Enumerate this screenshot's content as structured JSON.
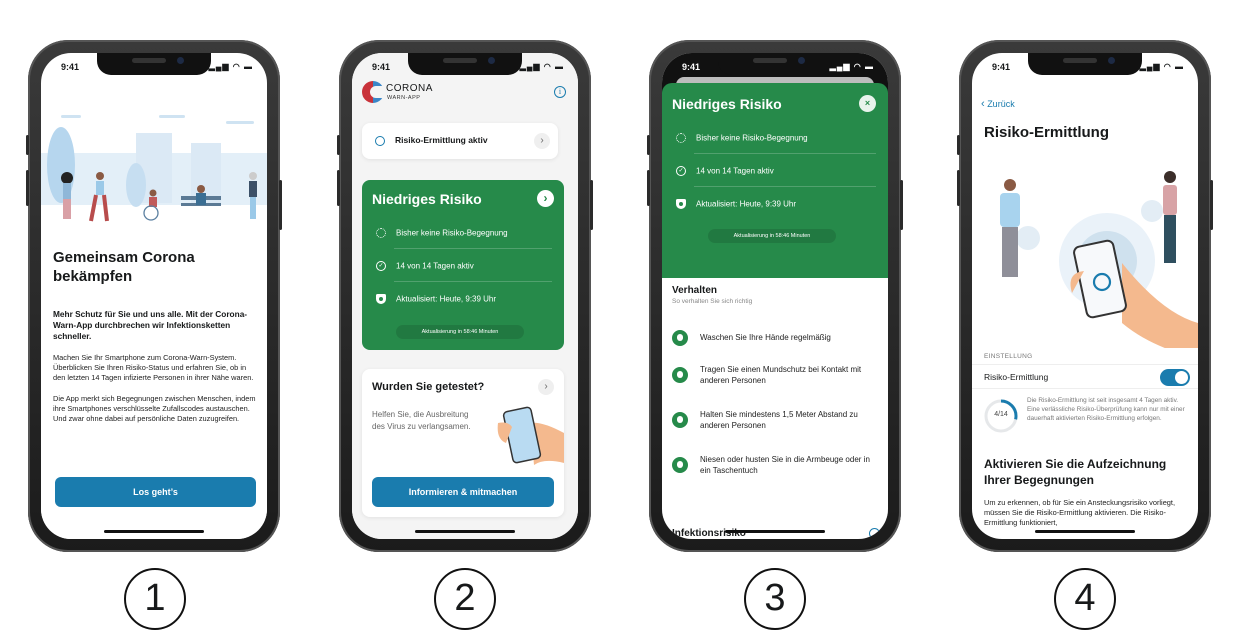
{
  "status_bar": {
    "time": "9:41",
    "icons": "signal wifi battery"
  },
  "step_numbers": [
    "1",
    "2",
    "3",
    "4"
  ],
  "screen1": {
    "title": "Gemeinsam Corona bekämpfen",
    "lead": "Mehr Schutz für Sie und uns alle. Mit der Corona-Warn-App durchbrechen wir Infektionsketten schneller.",
    "paragraphs": [
      "Machen Sie Ihr Smartphone zum Corona-Warn-System. Überblicken Sie Ihren Risiko-Status und erfahren Sie, ob in den letzten 14 Tagen infizierte Personen in ihrer Nähe waren.",
      "Die App merkt sich Begegnungen zwischen Menschen, indem ihre Smartphones verschlüsselte Zufallscodes austauschen. Und zwar ohne dabei auf persönliche Daten zuzugreifen."
    ],
    "button_label": "Los geht’s"
  },
  "screen2": {
    "logo_line1": "CORONA",
    "logo_line2": "WARN-APP",
    "info_icon": "i",
    "tracing_status": "Risiko-Ermittlung aktiv",
    "chevron": "›",
    "risk_card": {
      "title": "Niedriges Risiko",
      "rows": [
        "Bisher keine Risiko-Begegnung",
        "14 von 14 Tagen aktiv",
        "Aktualisiert: Heute, 9:39 Uhr"
      ],
      "update_pill": "Aktualisierung in 58:46 Minuten"
    },
    "test_card": {
      "title": "Wurden Sie getestet?",
      "text": "Helfen Sie, die Ausbreitung des Virus zu verlangsamen.",
      "button_label": "Informieren & mitmachen"
    }
  },
  "screen3": {
    "title": "Niedriges Risiko",
    "close_icon": "×",
    "rows": [
      "Bisher keine Risiko-Begegnung",
      "14 von 14 Tagen aktiv",
      "Aktualisiert: Heute, 9:39 Uhr"
    ],
    "update_pill": "Aktualisierung in 58:46 Minuten",
    "behavior_title": "Verhalten",
    "behavior_subtitle": "So verhalten Sie sich richtig",
    "behavior_items": [
      "Waschen Sie Ihre Hände regelmäßig",
      "Tragen Sie einen Mundschutz bei Kontakt mit anderen Personen",
      "Halten Sie mindestens 1,5 Meter Abstand zu anderen Personen",
      "Niesen oder husten Sie in die Armbeuge oder in ein Taschentuch"
    ],
    "next_section_partial": "Infektionsrisiko"
  },
  "screen4": {
    "back_label": "Zurück",
    "title": "Risiko-Ermittlung",
    "section_label": "EINSTELLUNG",
    "setting_label": "Risiko-Ermittlung",
    "toggle_on": true,
    "progress_text": "4/14",
    "progress_fraction": 0.2857,
    "progress_desc": "Die Risiko-Ermittlung ist seit insgesamt 4 Tagen aktiv. Eine verlässliche Risiko-Überprüfung kann nur mit einer dauerhaft aktivierten Risiko-Ermittlung erfolgen.",
    "heading": "Aktivieren Sie die Aufzeichnung Ihrer Begegnungen",
    "body": "Um zu erkennen, ob für Sie ein Ansteckungsrisiko vorliegt, müssen Sie die Risiko-Ermittlung aktivieren. Die Risiko-Ermittlung funktioniert,"
  },
  "colors": {
    "green": "#268a4a",
    "blue": "#1a7cae"
  }
}
